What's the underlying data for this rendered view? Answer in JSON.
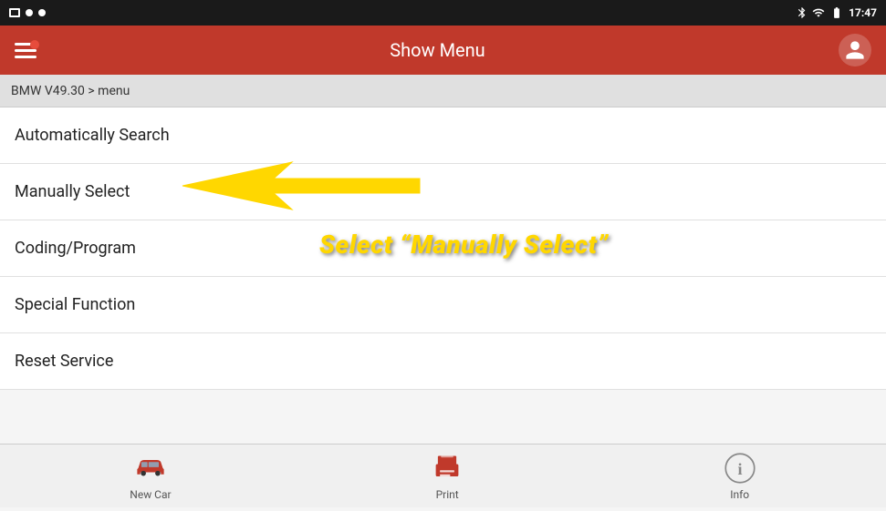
{
  "statusBar": {
    "time": "17:47"
  },
  "header": {
    "title": "Show Menu"
  },
  "breadcrumb": {
    "text": "BMW V49.30 > menu"
  },
  "menuItems": [
    {
      "id": "auto-search",
      "label": "Automatically Search"
    },
    {
      "id": "manually-select",
      "label": "Manually Select"
    },
    {
      "id": "coding-program",
      "label": "Coding/Program"
    },
    {
      "id": "special-function",
      "label": "Special Function"
    },
    {
      "id": "reset-service",
      "label": "Reset Service"
    }
  ],
  "annotation": {
    "text": "Select “Manually Select”"
  },
  "bottomBar": {
    "buttons": [
      {
        "id": "new-car",
        "label": "New Car"
      },
      {
        "id": "print",
        "label": "Print"
      },
      {
        "id": "info",
        "label": "Info"
      }
    ]
  }
}
